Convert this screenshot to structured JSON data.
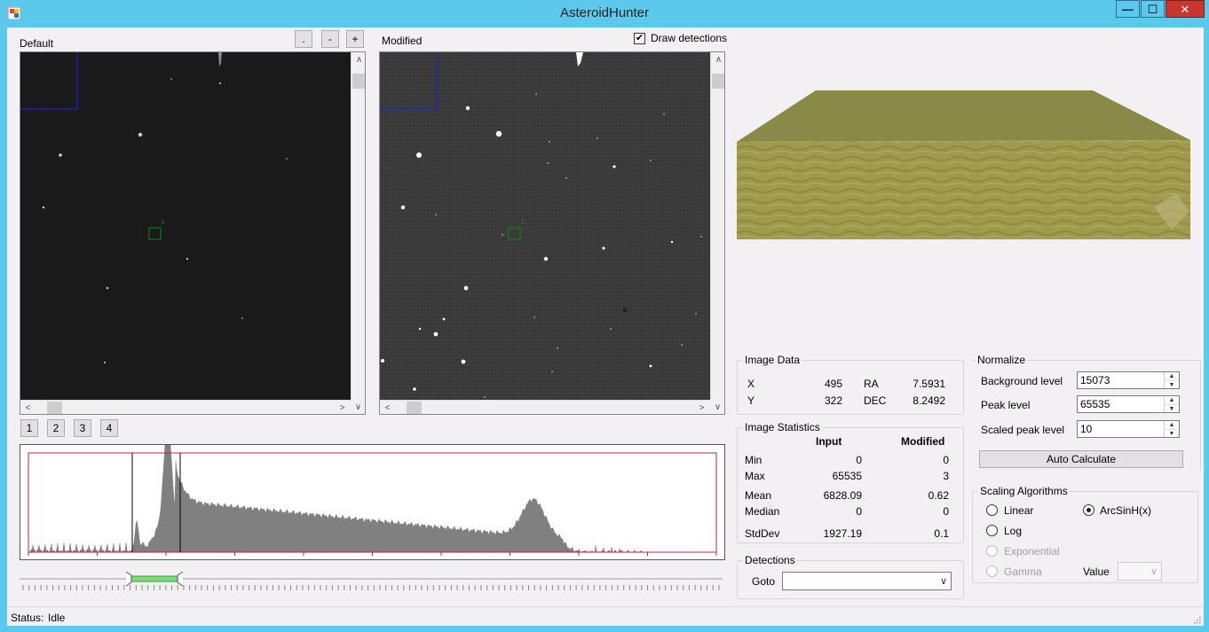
{
  "window": {
    "title": "AsteroidHunter",
    "min_glyph": "—",
    "max_glyph": "☐",
    "close_glyph": "✕"
  },
  "left_view": {
    "label": "Default",
    "buttons": [
      ".",
      "-",
      "+"
    ]
  },
  "right_view": {
    "label": "Modified",
    "draw_detections": {
      "label": "Draw detections",
      "checked": true,
      "check_glyph": "✔"
    }
  },
  "scroll_glyphs": {
    "up": "∧",
    "down": "∨",
    "left": "<",
    "right": ">"
  },
  "detection_marker_label": "5",
  "page_buttons": [
    "1",
    "2",
    "3",
    "4"
  ],
  "image_data": {
    "title": "Image Data",
    "x_label": "X",
    "x_value": "495",
    "y_label": "Y",
    "y_value": "322",
    "ra_label": "RA",
    "ra_value": "7.5931",
    "dec_label": "DEC",
    "dec_value": "8.2492"
  },
  "image_statistics": {
    "title": "Image Statistics",
    "col_input": "Input",
    "col_modified": "Modified",
    "rows": [
      {
        "label": "Min",
        "input": "0",
        "modified": "0"
      },
      {
        "label": "Max",
        "input": "65535",
        "modified": "3"
      },
      {
        "label": "Mean",
        "input": "6828.09",
        "modified": "0.62"
      },
      {
        "label": "Median",
        "input": "0",
        "modified": "0"
      },
      {
        "label": "StdDev",
        "input": "1927.19",
        "modified": "0.1"
      }
    ]
  },
  "detections": {
    "title": "Detections",
    "goto_label": "Goto",
    "goto_value": ""
  },
  "normalize": {
    "title": "Normalize",
    "background_label": "Background level",
    "background_value": "15073",
    "peak_label": "Peak level",
    "peak_value": "65535",
    "scaled_peak_label": "Scaled peak level",
    "scaled_peak_value": "10",
    "auto_calculate": "Auto Calculate"
  },
  "scaling": {
    "title": "Scaling Algorithms",
    "options": [
      {
        "label": "Linear",
        "selected": false,
        "enabled": true
      },
      {
        "label": "ArcSinH(x)",
        "selected": true,
        "enabled": true
      },
      {
        "label": "Log",
        "selected": false,
        "enabled": true
      },
      {
        "label": "Exponential",
        "selected": false,
        "enabled": false
      },
      {
        "label": "Gamma",
        "selected": false,
        "enabled": false
      }
    ],
    "value_label": "Value",
    "value": ""
  },
  "status": {
    "label": "Status:",
    "value": "Idle"
  },
  "colors": {
    "title_bar": "#5bc8ec",
    "histogram_fill": "#808080",
    "histogram_axis": "#c0282c",
    "slider_range": "#7ddc7a",
    "detection_box": "#0b8a15",
    "roi_box": "#1a26c8",
    "terrain_top": "#8a8a48",
    "terrain_face": "#a09a4c"
  }
}
